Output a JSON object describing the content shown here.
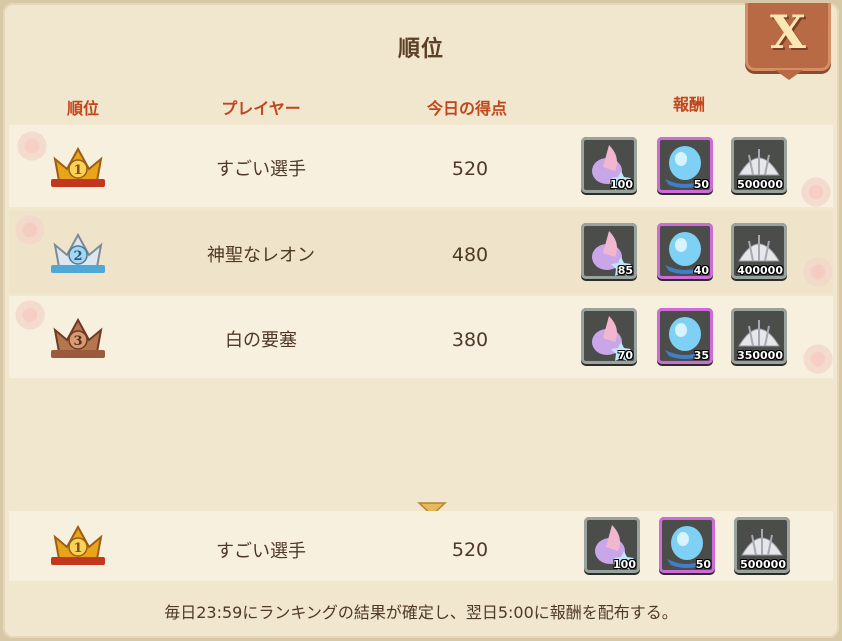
{
  "title": "順位",
  "headers": {
    "rank": "順位",
    "player": "プレイヤー",
    "score": "今日の得点",
    "reward": "報酬"
  },
  "close_icon": "close-icon",
  "close_label": "X",
  "rows": [
    {
      "rank": "1",
      "player": "すごい選手",
      "score": "520",
      "rewards": [
        "100",
        "50",
        "500000"
      ]
    },
    {
      "rank": "2",
      "player": "神聖なレオン",
      "score": "480",
      "rewards": [
        "85",
        "40",
        "400000"
      ]
    },
    {
      "rank": "3",
      "player": "白の要塞",
      "score": "380",
      "rewards": [
        "70",
        "35",
        "350000"
      ]
    }
  ],
  "my_rank": {
    "rank": "1",
    "player": "すごい選手",
    "score": "520",
    "rewards": [
      "100",
      "50",
      "500000"
    ]
  },
  "note": "毎日23:59にランキングの結果が確定し、翌日5:00に報酬を配布する。",
  "colors": {
    "gold": "#e8a51b",
    "silver": "#a7d7ef",
    "bronze": "#9b5a3c",
    "accent": "#c1461d"
  }
}
